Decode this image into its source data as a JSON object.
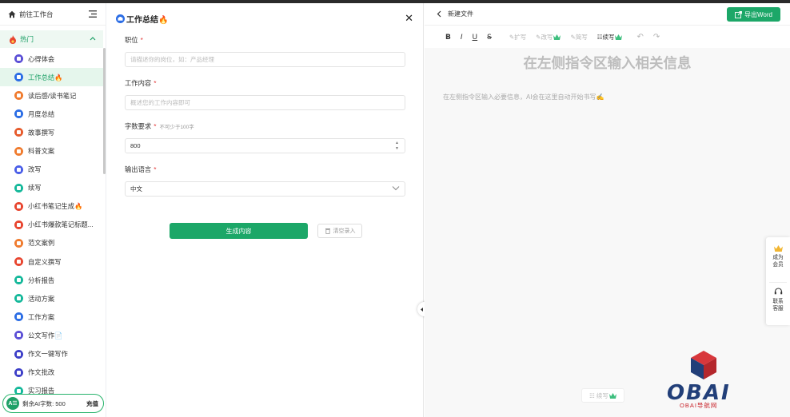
{
  "sidebar": {
    "home_label": "前往工作台",
    "category": "热门",
    "items": [
      {
        "label": "心得体会",
        "icon": "document-icon",
        "color": "#5b4fd6"
      },
      {
        "label": "工作总结🔥",
        "icon": "briefcase-icon",
        "color": "#2b6de5",
        "active": true
      },
      {
        "label": "读后感/读书笔记",
        "icon": "book-icon",
        "color": "#f07b2e"
      },
      {
        "label": "月度总结",
        "icon": "calendar-icon",
        "color": "#2b6de5"
      },
      {
        "label": "故事撰写",
        "icon": "story-icon",
        "color": "#e65a2b"
      },
      {
        "label": "科普文案",
        "icon": "flask-icon",
        "color": "#f07b2e"
      },
      {
        "label": "改写",
        "icon": "edit-icon",
        "color": "#4a5ee8"
      },
      {
        "label": "续写",
        "icon": "pen-icon",
        "color": "#14b89a"
      },
      {
        "label": "小红书笔记生成🔥",
        "icon": "xiaohongshu-icon",
        "color": "#e8452f"
      },
      {
        "label": "小红书爆款笔记标题...",
        "icon": "xiaohongshu-icon",
        "color": "#e8452f"
      },
      {
        "label": "范文案例",
        "icon": "sample-icon",
        "color": "#f07b2e"
      },
      {
        "label": "自定义撰写",
        "icon": "custom-icon",
        "color": "#e8452f"
      },
      {
        "label": "分析报告",
        "icon": "chart-icon",
        "color": "#14b89a"
      },
      {
        "label": "活动方案",
        "icon": "event-icon",
        "color": "#14b89a"
      },
      {
        "label": "工作方案",
        "icon": "plan-icon",
        "color": "#2b6de5"
      },
      {
        "label": "公文写作📄",
        "icon": "official-icon",
        "color": "#5b4fd6"
      },
      {
        "label": "作文一键写作",
        "icon": "graduation-icon",
        "color": "#3d3fc8"
      },
      {
        "label": "作文批改",
        "icon": "graduation-icon",
        "color": "#3d3fc8"
      },
      {
        "label": "实习报告",
        "icon": "report-icon",
        "color": "#14b89a"
      }
    ],
    "remaining_label": "剩余AI字数: 500",
    "recharge_label": "充值",
    "badge": "A☰"
  },
  "form": {
    "title": "工作总结🔥",
    "position_label": "职位",
    "position_placeholder": "请描述你的岗位，如：产品经理",
    "content_label": "工作内容",
    "content_placeholder": "概述您的工作内容即可",
    "wordcount_label": "字数要求",
    "wordcount_hint": "不可少于100字",
    "wordcount_value": "800",
    "language_label": "输出语言",
    "language_value": "中文",
    "generate_label": "生成内容",
    "clear_label": "清空录入",
    "required_mark": "*"
  },
  "editor": {
    "file_name": "新建文件",
    "export_label": "导出Word",
    "toolbar": {
      "bold": "B",
      "italic": "I",
      "underline": "U",
      "strike": "S",
      "expand": "扩写",
      "rewrite": "改写",
      "condense": "简写",
      "continue": "续写"
    },
    "heading": "在左侧指令区输入相关信息",
    "tip": "在左侧指令区输入必要信息，AI会在这里自动开始书写✍️",
    "continue_button": "续写"
  },
  "float_panel": {
    "member_label_1": "成为",
    "member_label_2": "会员",
    "support_label_1": "联系",
    "support_label_2": "客服"
  },
  "logo": {
    "text": "OBAI",
    "subtitle": "OBAI导航网"
  },
  "colors": {
    "accent": "#1ca768",
    "active_bg": "#e5f6ec"
  }
}
